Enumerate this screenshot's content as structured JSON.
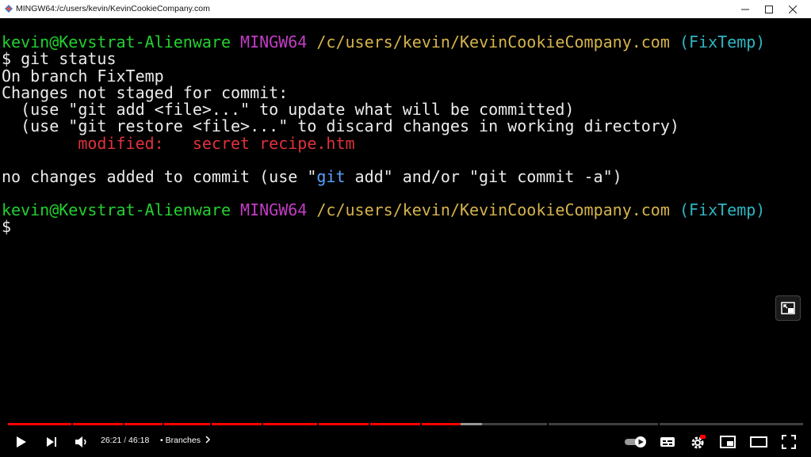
{
  "window": {
    "title": "MINGW64:/c/users/kevin/KevinCookieCompany.com"
  },
  "terminal": {
    "prompt1": {
      "user": "kevin@Kevstrat-Alienware",
      "env": "MINGW64",
      "path": "/c/users/kevin/KevinCookieCompany.com",
      "branch": "(FixTemp)"
    },
    "cmd1": "$ git status",
    "out_branch": "On branch FixTemp",
    "out_changes": "Changes not staged for commit:",
    "out_hint1": "  (use \"git add <file>...\" to update what will be committed)",
    "out_hint2": "  (use \"git restore <file>...\" to discard changes in working directory)",
    "modified_label": "        modified:",
    "modified_file": "   secret recipe.htm",
    "out_nochanges_pre": "no changes added to commit (use \"",
    "out_nochanges_highlight": "git",
    "out_nochanges_post": " add\" and/or \"git commit -a\")",
    "prompt2": {
      "user": "kevin@Kevstrat-Alienware",
      "env": "MINGW64",
      "path": "/c/users/kevin/KevinCookieCompany.com",
      "branch": "(FixTemp)"
    },
    "cursor_prompt": "$"
  },
  "player": {
    "current_time": "26:21",
    "separator": "/",
    "duration": "46:18",
    "bullet": "•",
    "chapter": "Branches",
    "progress_played": 0.5691,
    "progress_buffered": 0.5962,
    "autoplay_on": true,
    "settings_badge": "HD",
    "colors": {
      "played": "#ff0000"
    }
  },
  "icons": [
    "app-icon",
    "minimize-icon",
    "maximize-icon",
    "close-icon",
    "miniplayer-icon",
    "play-icon",
    "next-icon",
    "volume-icon",
    "chevron-right-icon",
    "autoplay-toggle-icon",
    "subtitles-icon",
    "settings-icon",
    "miniplayer-toggle-icon",
    "theater-icon",
    "fullscreen-icon"
  ]
}
